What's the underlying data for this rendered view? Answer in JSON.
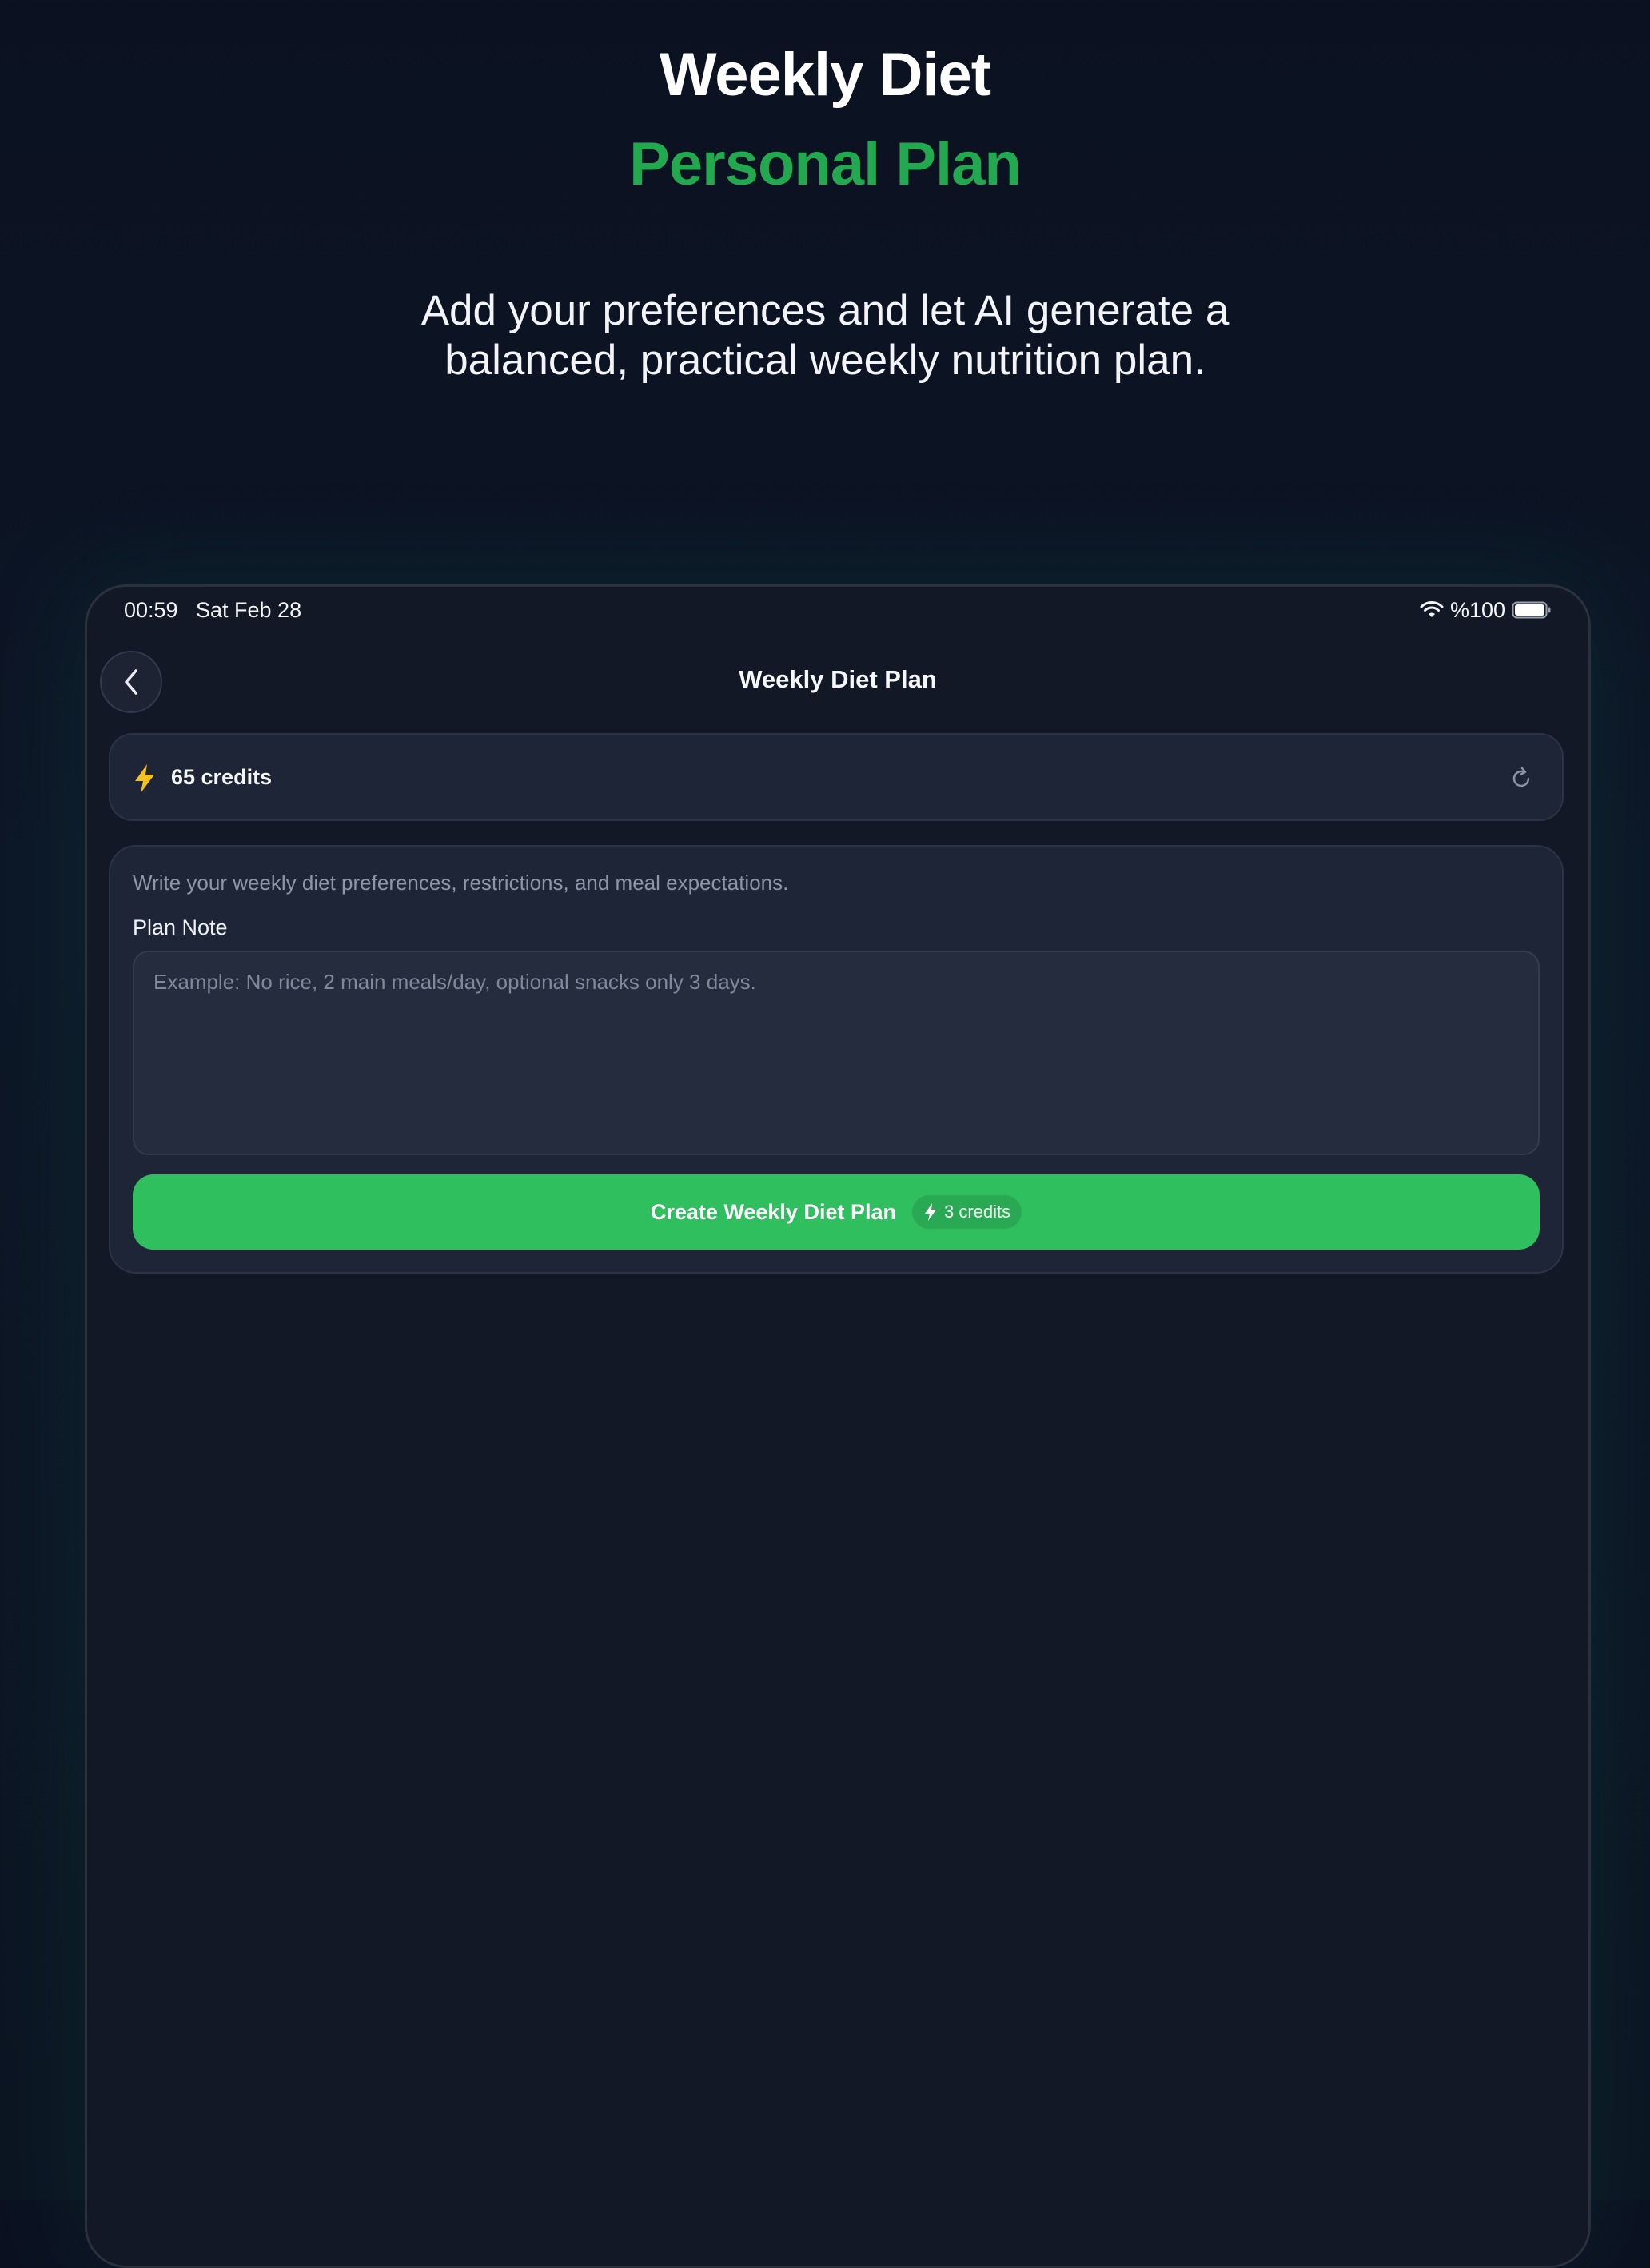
{
  "hero": {
    "title": "Weekly Diet",
    "subtitle": "Personal Plan",
    "description": "Add your preferences and let AI generate a balanced, practical weekly nutrition plan."
  },
  "status_bar": {
    "time": "00:59",
    "date": "Sat Feb 28",
    "battery": "%100"
  },
  "nav": {
    "title": "Weekly Diet Plan"
  },
  "credits": {
    "text": "65 credits"
  },
  "plan_form": {
    "instruction": "Write your weekly diet preferences, restrictions, and meal expectations.",
    "label": "Plan Note",
    "placeholder": "Example: No rice, 2 main meals/day, optional snacks only 3 days.",
    "value": "",
    "button_label": "Create Weekly Diet Plan",
    "cost_label": "3 credits"
  },
  "colors": {
    "accent_green": "#22a84e",
    "button_green": "#2fbf5e",
    "bolt_yellow": "#f5c21b",
    "background": "#0b1120",
    "card": "#1e2536"
  },
  "icons": {
    "back": "chevron-left-icon",
    "credits": "lightning-bolt-icon",
    "refresh": "refresh-icon",
    "wifi": "wifi-icon",
    "battery": "battery-icon"
  }
}
